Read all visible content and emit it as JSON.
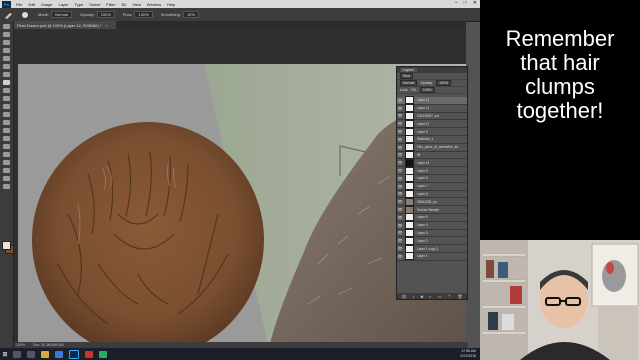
{
  "menubar": {
    "logo": "Ps",
    "items": [
      "File",
      "Edit",
      "Image",
      "Layer",
      "Type",
      "Select",
      "Filter",
      "3D",
      "View",
      "Window",
      "Help"
    ],
    "window_controls": [
      "–",
      "□",
      "✕"
    ]
  },
  "options_bar": {
    "mode_label": "Mode:",
    "mode_value": "Normal",
    "opacity_label": "Opacity:",
    "opacity_value": "100%",
    "flow_label": "Flow:",
    "flow_value": "100%",
    "smoothing_label": "Smoothing:",
    "smoothing_value": "10%"
  },
  "document_tab": {
    "title": "Final Dream.psd @ 100% (Layer 12, RGB/8#) *",
    "close": "×"
  },
  "status_bar": {
    "zoom": "100%",
    "doc_size": "Doc: 30.3M/489.4M"
  },
  "layers_panel": {
    "tab_label": "Layers",
    "kind_label": "Kind",
    "blend_mode": "Normal",
    "opacity_label": "Opacity:",
    "opacity_value": "100%",
    "lock_label": "Lock:",
    "fill_label": "Fill:",
    "fill_value": "100%",
    "layers": [
      {
        "name": "Layer 12",
        "selected": true
      },
      {
        "name": "Layer 11"
      },
      {
        "name": "102219097_a.d"
      },
      {
        "name": "Layer 10"
      },
      {
        "name": "Layer 9"
      },
      {
        "name": "Wallcube_s"
      },
      {
        "name": "Film_piece_of_ooeberthe_thr"
      },
      {
        "name": "tfff"
      },
      {
        "name": "Layer 18"
      },
      {
        "name": "Layer 8"
      },
      {
        "name": "Layer 5"
      },
      {
        "name": "Layer 7"
      },
      {
        "name": "Layer 6"
      },
      {
        "name": "03001328_a.d"
      },
      {
        "name": "Texture Sample"
      },
      {
        "name": "Layer 5"
      },
      {
        "name": "Layer 4"
      },
      {
        "name": "Layer 3"
      },
      {
        "name": "Layer 2"
      },
      {
        "name": "Layer 1 copy 2"
      },
      {
        "name": "Layer 1"
      }
    ],
    "footer_icons": [
      "link-icon",
      "fx-icon",
      "mask-icon",
      "adjustment-icon",
      "folder-icon",
      "new-layer-icon",
      "trash-icon"
    ]
  },
  "taskbar": {
    "time": "17:56 AM",
    "date": "2/21/2018"
  },
  "caption": {
    "line1": "Remember",
    "line2": "that hair",
    "line3": "clumps",
    "line4": "together!"
  },
  "colors": {
    "ps_bg": "#535353",
    "canvas_bg": "#999999",
    "fur_brown": "#7a4e30",
    "caption_text": "#ffffff"
  }
}
